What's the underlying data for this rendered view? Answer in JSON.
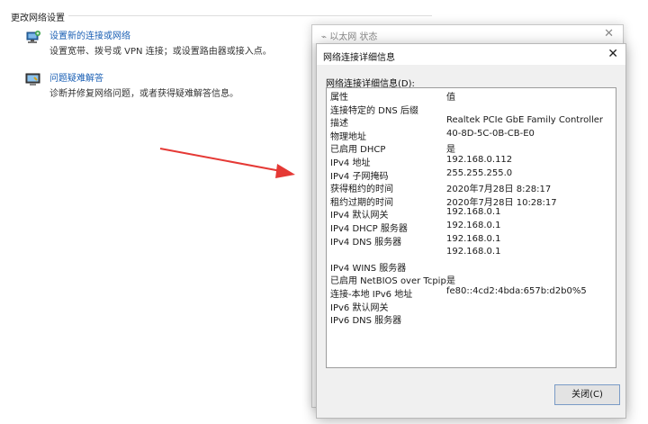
{
  "section_title": "更改网络设置",
  "actions": [
    {
      "link": "设置新的连接或网络",
      "desc": "设置宽带、拨号或 VPN 连接；或设置路由器或接入点。"
    },
    {
      "link": "问题疑难解答",
      "desc": "诊断并修复网络问题，或者获得疑难解答信息。"
    }
  ],
  "bg_window": {
    "title": "以太网 状态",
    "close": "✕"
  },
  "dialog": {
    "title": "网络连接详细信息",
    "close": "✕",
    "subtitle": "网络连接详细信息(D):",
    "rows": [
      {
        "k": "属性",
        "v": "值"
      },
      {
        "k": "连接特定的 DNS 后缀",
        "v": ""
      },
      {
        "k": "描述",
        "v": "Realtek PCIe GbE Family Controller"
      },
      {
        "k": "物理地址",
        "v": "40-8D-5C-0B-CB-E0"
      },
      {
        "k": "已启用 DHCP",
        "v": "是"
      },
      {
        "k": "IPv4 地址",
        "v": "192.168.0.112"
      },
      {
        "k": "IPv4 子网掩码",
        "v": "255.255.255.0"
      },
      {
        "k": "获得租约的时间",
        "v": "2020年7月28日 8:28:17"
      },
      {
        "k": "租约过期的时间",
        "v": "2020年7月28日 10:28:17"
      },
      {
        "k": "IPv4 默认网关",
        "v": "192.168.0.1"
      },
      {
        "k": "IPv4 DHCP 服务器",
        "v": "192.168.0.1"
      },
      {
        "k": "IPv4 DNS 服务器",
        "v": "192.168.0.1"
      },
      {
        "k": "",
        "v": "192.168.0.1"
      },
      {
        "k": "IPv4 WINS 服务器",
        "v": ""
      },
      {
        "k": "已启用 NetBIOS over Tcpip",
        "v": "是"
      },
      {
        "k": "连接-本地 IPv6 地址",
        "v": "fe80::4cd2:4bda:657b:d2b0%5"
      },
      {
        "k": "IPv6 默认网关",
        "v": ""
      },
      {
        "k": "IPv6 DNS 服务器",
        "v": ""
      }
    ],
    "close_button": "关闭(C)"
  },
  "colors": {
    "link": "#1a5fb4",
    "arrow": "#e53935"
  }
}
